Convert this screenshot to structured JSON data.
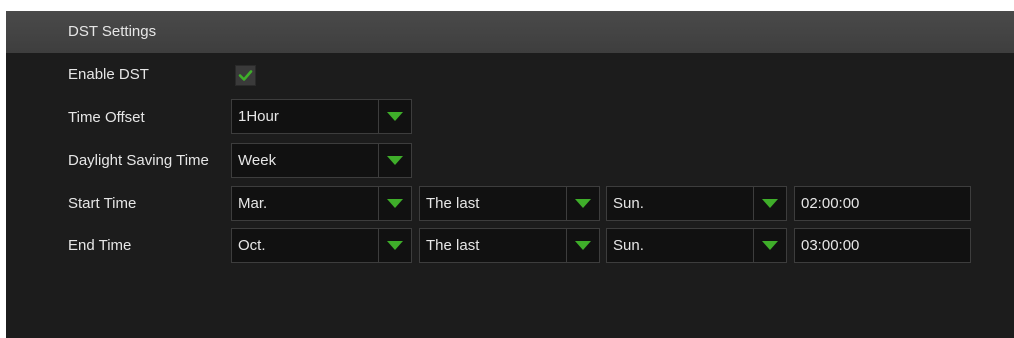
{
  "header": {
    "title": "DST Settings"
  },
  "colors": {
    "accent": "#3fae2a",
    "panel_bg": "#1c1c1c",
    "field_bg": "#111111",
    "header_bg": "#444444"
  },
  "enable_dst": {
    "label": "Enable DST",
    "checked": true,
    "icon": "checkmark-icon"
  },
  "time_offset": {
    "label": "Time Offset",
    "value": "1Hour",
    "icon": "triangle-down-icon"
  },
  "daylight_saving_time": {
    "label": "Daylight Saving Time",
    "value": "Week",
    "icon": "triangle-down-icon"
  },
  "start_time": {
    "label": "Start Time",
    "month": "Mar.",
    "week": "The last",
    "day": "Sun.",
    "time": "02:00:00"
  },
  "end_time": {
    "label": "End Time",
    "month": "Oct.",
    "week": "The last",
    "day": "Sun.",
    "time": "03:00:00"
  }
}
